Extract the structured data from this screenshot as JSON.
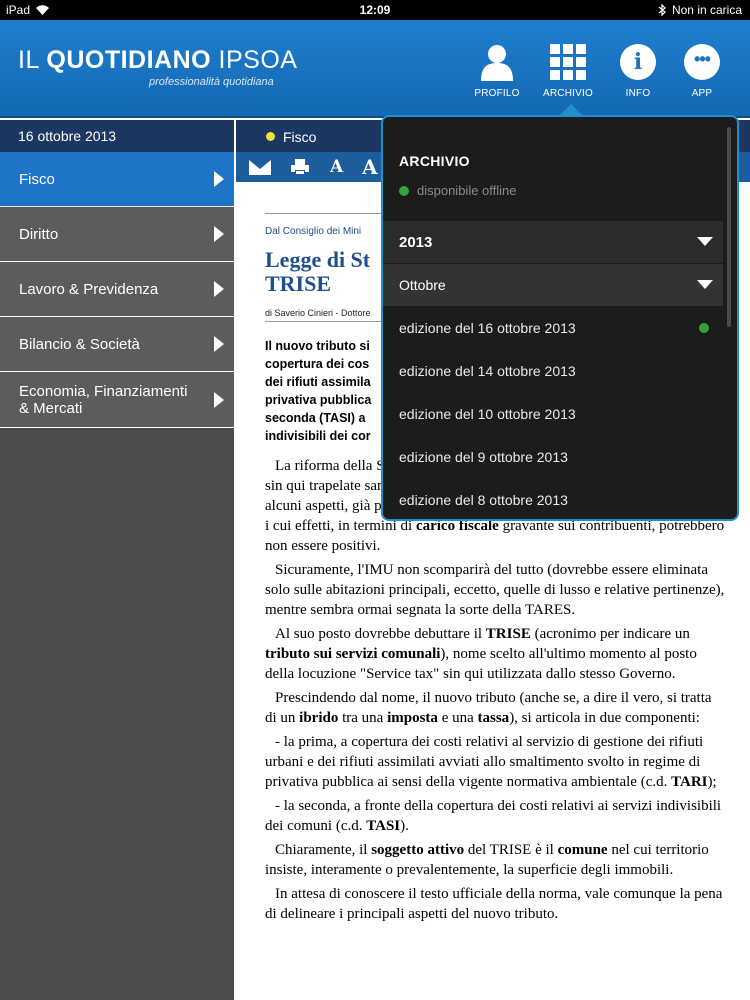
{
  "status": {
    "device": "iPad",
    "time": "12:09",
    "battery_text": "Non in carica"
  },
  "header": {
    "brand_il": "IL ",
    "brand_quotidiano": "QUOTIDIANO",
    "brand_ipsoa": " IPSOA",
    "brand_sub": "professionalità quotidiana",
    "nav": [
      {
        "label": "PROFILO",
        "icon": "person-icon"
      },
      {
        "label": "ARCHIVIO",
        "icon": "grid-icon"
      },
      {
        "label": "INFO",
        "icon": "info-icon"
      },
      {
        "label": "APP",
        "icon": "more-icon"
      }
    ],
    "info_glyph": "i",
    "app_glyph": "•••"
  },
  "date_bar": "16 ottobre 2013",
  "sidebar": {
    "items": [
      {
        "label": "Fisco",
        "active": true
      },
      {
        "label": "Diritto"
      },
      {
        "label": "Lavoro & Previdenza"
      },
      {
        "label": "Bilancio & Società"
      },
      {
        "label": "Economia, Finanziamenti & Mercati"
      }
    ]
  },
  "section": {
    "label": "Fisco"
  },
  "toolbar": {
    "font_small": "A",
    "font_large": "A"
  },
  "article": {
    "source": "Dal Consiglio dei Mini",
    "title": "Legge di St TRISE",
    "author": "di Saverio Cinieri - Dottore",
    "abstract": "Il nuovo tributo si copertura dei cos dei rifiuti assimila privativa pubblica seconda (TASI) a indivisibili dei cor",
    "body": [
      {
        "html": "La riforma della Stabilità di quest'a per i contribuenti. legge, se le notizie sin qui trapelate saranno confermate, a partire dal prossimo anno (ma su alcuni aspetti, già per l'anno in corso), ci sarà una vera e propria rivoluzione i cui effetti, in termini di <b>carico fiscale</b> gravante sui contribuenti, potrebbero non essere positivi."
      },
      {
        "html": "Sicuramente, l'IMU non scomparirà del tutto (dovrebbe essere eliminata solo sulle abitazioni principali, eccetto, quelle di lusso e relative pertinenze), mentre sembra ormai segnata la sorte della TARES."
      },
      {
        "html": "Al suo posto dovrebbe debuttare il <b>TRISE</b> (acronimo per indicare un <b>tributo sui servizi comunali</b>), nome scelto all'ultimo momento al posto della locuzione \"Service tax\" sin qui utilizzata dallo stesso Governo."
      },
      {
        "html": "Prescindendo dal nome, il nuovo tributo (anche se, a dire il vero, si tratta di un <b>ibrido</b> tra una <b>imposta</b> e una <b>tassa</b>), si articola in due componenti:"
      },
      {
        "html": "- la prima, a copertura dei costi relativi al servizio di gestione dei rifiuti urbani e dei rifiuti assimilati avviati allo smaltimento svolto in regime di privativa pubblica ai sensi della vigente normativa ambientale (c.d. <b>TARI</b>);"
      },
      {
        "html": "- la seconda, a fronte della copertura dei costi relativi ai servizi indivisibili dei comuni (c.d. <b>TASI</b>)."
      },
      {
        "html": "Chiaramente, il <b>soggetto attivo</b> del TRISE è il <b>comune</b> nel cui territorio insiste, interamente o prevalentemente, la superficie degli immobili."
      },
      {
        "html": "In attesa di conoscere il testo ufficiale della norma, vale comunque la pena di delineare i principali aspetti del nuovo tributo."
      }
    ]
  },
  "archive": {
    "title": "ARCHIVIO",
    "offline": "disponibile offline",
    "year": "2013",
    "month": "Ottobre",
    "editions": [
      {
        "label": "edizione del 16 ottobre 2013",
        "offline": true
      },
      {
        "label": "edizione del 14 ottobre 2013"
      },
      {
        "label": "edizione del 10 ottobre 2013"
      },
      {
        "label": "edizione del 9 ottobre 2013"
      },
      {
        "label": "edizione del 8 ottobre 2013"
      }
    ]
  },
  "colors": {
    "header_blue": "#1a74c0",
    "nav_dark": "#1d3763",
    "active_blue": "#1e74c6",
    "popover_border": "#1e8fc9",
    "offline_green": "#3aa13a"
  }
}
